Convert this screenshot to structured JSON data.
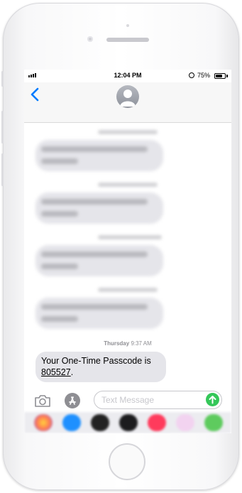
{
  "status_bar": {
    "time": "12:04 PM",
    "battery_percent": "75%",
    "battery_level": 0.75
  },
  "nav": {
    "back_icon": "chevron-left-icon",
    "contact_icon": "person-silhouette-icon"
  },
  "thread": {
    "latest_timestamp_day": "Thursday",
    "latest_timestamp_time": "9:37 AM",
    "latest_message_prefix": "Your One-Time Passcode is ",
    "latest_message_code": "805527",
    "latest_message_suffix": "."
  },
  "compose": {
    "placeholder": "Text Message",
    "camera_icon": "camera-icon",
    "apps_icon": "app-store-icon",
    "send_icon": "arrow-up-icon"
  },
  "colors": {
    "accent": "#007aff",
    "send": "#34c759",
    "received_bubble": "#e5e5ea"
  }
}
